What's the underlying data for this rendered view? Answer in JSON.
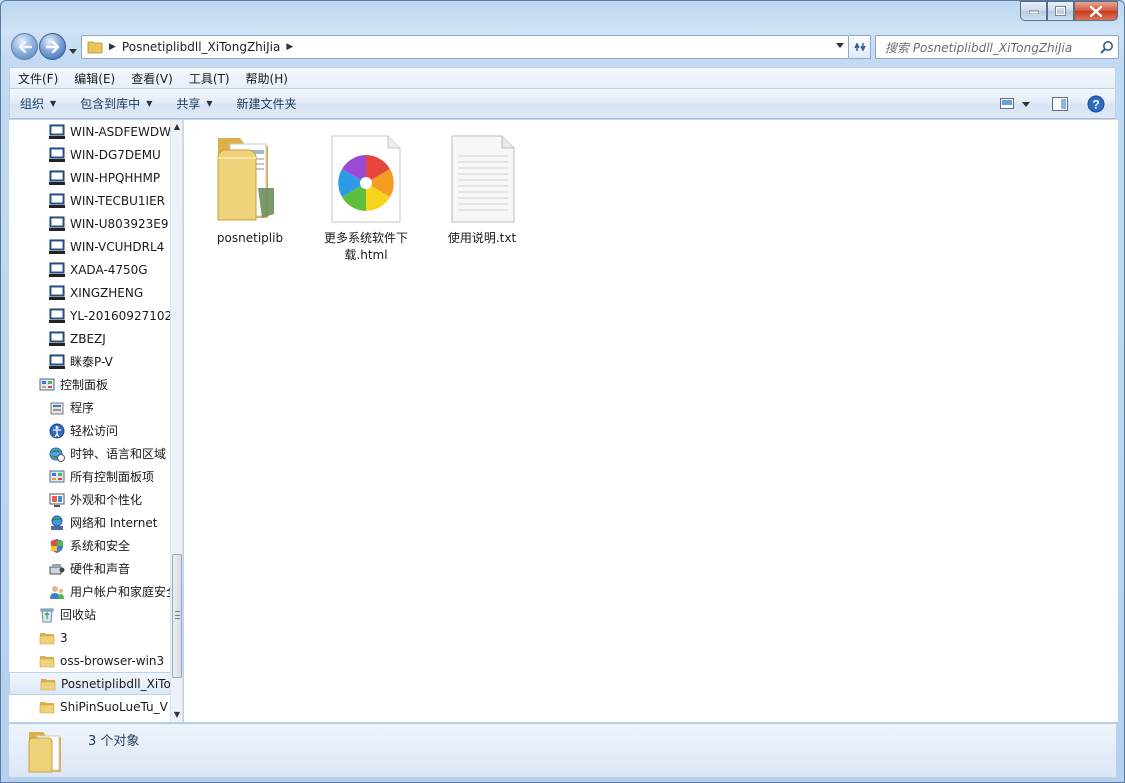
{
  "address": {
    "path_segment": "Posnetiplibdll_XiTongZhiJia",
    "search_placeholder": "搜索 Posnetiplibdll_XiTongZhiJia"
  },
  "menu": [
    "文件(F)",
    "编辑(E)",
    "查看(V)",
    "工具(T)",
    "帮助(H)"
  ],
  "commands": {
    "organize": "组织",
    "include_library": "包含到库中",
    "share": "共享",
    "new_folder": "新建文件夹"
  },
  "nav_items": [
    {
      "label": "WIN-ASDFEWDW",
      "icon": "computer-icon",
      "indent": 2
    },
    {
      "label": "WIN-DG7DEMU",
      "icon": "computer-icon",
      "indent": 2
    },
    {
      "label": "WIN-HPQHHMP",
      "icon": "computer-icon",
      "indent": 2
    },
    {
      "label": "WIN-TECBU1IER",
      "icon": "computer-icon",
      "indent": 2
    },
    {
      "label": "WIN-U803923E9",
      "icon": "computer-icon",
      "indent": 2
    },
    {
      "label": "WIN-VCUHDRL4",
      "icon": "computer-icon",
      "indent": 2
    },
    {
      "label": "XADA-4750G",
      "icon": "computer-icon",
      "indent": 2
    },
    {
      "label": "XINGZHENG",
      "icon": "computer-icon",
      "indent": 2
    },
    {
      "label": "YL-20160927102",
      "icon": "computer-icon",
      "indent": 2
    },
    {
      "label": "ZBEZJ",
      "icon": "computer-icon",
      "indent": 2
    },
    {
      "label": "眯泰P-V",
      "icon": "computer-icon",
      "indent": 2
    },
    {
      "label": "控制面板",
      "icon": "control-panel-icon",
      "indent": 1
    },
    {
      "label": "程序",
      "icon": "programs-icon",
      "indent": 2
    },
    {
      "label": "轻松访问",
      "icon": "ease-of-access-icon",
      "indent": 2
    },
    {
      "label": "时钟、语言和区域",
      "icon": "clock-globe-icon",
      "indent": 2
    },
    {
      "label": "所有控制面板项",
      "icon": "control-panel-icon",
      "indent": 2
    },
    {
      "label": "外观和个性化",
      "icon": "appearance-icon",
      "indent": 2
    },
    {
      "label": "网络和 Internet",
      "icon": "network-icon",
      "indent": 2
    },
    {
      "label": "系统和安全",
      "icon": "system-security-icon",
      "indent": 2
    },
    {
      "label": "硬件和声音",
      "icon": "hardware-sound-icon",
      "indent": 2
    },
    {
      "label": "用户帐户和家庭安全",
      "icon": "user-accounts-icon",
      "indent": 2
    },
    {
      "label": "回收站",
      "icon": "recycle-bin-icon",
      "indent": 1
    },
    {
      "label": "3",
      "icon": "folder-icon",
      "indent": 1
    },
    {
      "label": "oss-browser-win3",
      "icon": "folder-icon",
      "indent": 1
    },
    {
      "label": "Posnetiplibdll_XiTo",
      "icon": "folder-icon",
      "indent": 1,
      "selected": true
    },
    {
      "label": "ShiPinSuoLueTu_V",
      "icon": "folder-icon",
      "indent": 1
    }
  ],
  "files": [
    {
      "name": "posnetiplib",
      "type": "folder",
      "icon": "folder-icon"
    },
    {
      "name": "更多系统软件下载.html",
      "type": "html",
      "icon": "browser-html-icon"
    },
    {
      "name": "使用说明.txt",
      "type": "txt",
      "icon": "text-file-icon"
    }
  ],
  "status": {
    "count_text": "3 个对象"
  },
  "colors": {
    "accent": "#1e395b",
    "selection": "#dce9f8"
  }
}
